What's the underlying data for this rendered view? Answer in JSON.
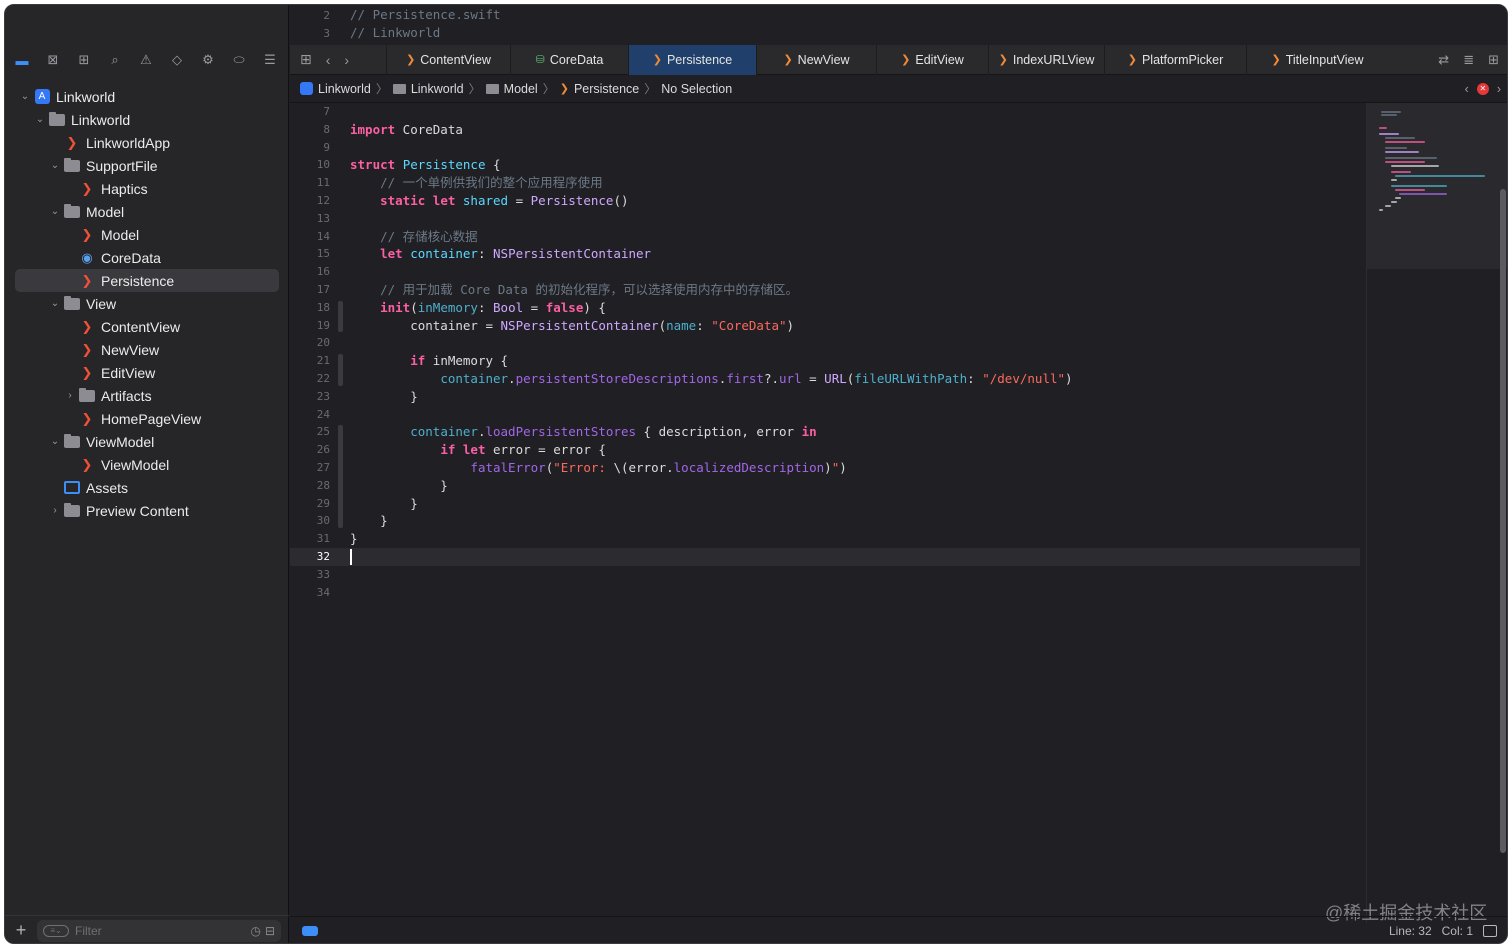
{
  "navigator": {
    "toolbar_icons": [
      "folder-icon",
      "source-control-icon",
      "symbol-icon",
      "find-icon",
      "issue-icon",
      "test-icon",
      "debug-icon",
      "breakpoint-icon",
      "report-icon"
    ],
    "tree": [
      {
        "label": "Linkworld",
        "indent": 0,
        "chevron": "⌄",
        "icon": "app"
      },
      {
        "label": "Linkworld",
        "indent": 1,
        "chevron": "⌄",
        "icon": "folder"
      },
      {
        "label": "LinkworldApp",
        "indent": 2,
        "chevron": "",
        "icon": "swift"
      },
      {
        "label": "SupportFile",
        "indent": 2,
        "chevron": "⌄",
        "icon": "folder"
      },
      {
        "label": "Haptics",
        "indent": 3,
        "chevron": "",
        "icon": "swift"
      },
      {
        "label": "Model",
        "indent": 2,
        "chevron": "⌄",
        "icon": "folder"
      },
      {
        "label": "Model",
        "indent": 3,
        "chevron": "",
        "icon": "swift"
      },
      {
        "label": "CoreData",
        "indent": 3,
        "chevron": "",
        "icon": "coredata"
      },
      {
        "label": "Persistence",
        "indent": 3,
        "chevron": "",
        "icon": "swift",
        "selected": true
      },
      {
        "label": "View",
        "indent": 2,
        "chevron": "⌄",
        "icon": "folder"
      },
      {
        "label": "ContentView",
        "indent": 3,
        "chevron": "",
        "icon": "swift"
      },
      {
        "label": "NewView",
        "indent": 3,
        "chevron": "",
        "icon": "swift"
      },
      {
        "label": "EditView",
        "indent": 3,
        "chevron": "",
        "icon": "swift"
      },
      {
        "label": "Artifacts",
        "indent": 3,
        "chevron": "›",
        "icon": "folder"
      },
      {
        "label": "HomePageView",
        "indent": 3,
        "chevron": "",
        "icon": "swift"
      },
      {
        "label": "ViewModel",
        "indent": 2,
        "chevron": "⌄",
        "icon": "folder"
      },
      {
        "label": "ViewModel",
        "indent": 3,
        "chevron": "",
        "icon": "swift"
      },
      {
        "label": "Assets",
        "indent": 2,
        "chevron": "",
        "icon": "assets"
      },
      {
        "label": "Preview Content",
        "indent": 2,
        "chevron": "›",
        "icon": "folder"
      }
    ],
    "filter_placeholder": "Filter"
  },
  "sticky": [
    {
      "num": "2",
      "text": "//  Persistence.swift"
    },
    {
      "num": "3",
      "text": "//  Linkworld"
    }
  ],
  "tabs": [
    {
      "label": "ContentView",
      "icon": "swift"
    },
    {
      "label": "CoreData",
      "icon": "coredata"
    },
    {
      "label": "Persistence",
      "icon": "swift",
      "active": true
    },
    {
      "label": "NewView",
      "icon": "swift"
    },
    {
      "label": "EditView",
      "icon": "swift"
    },
    {
      "label": "IndexURLView",
      "icon": "swift"
    },
    {
      "label": "PlatformPicker",
      "icon": "swift"
    },
    {
      "label": "TitleInputView",
      "icon": "swift"
    }
  ],
  "jumpbar": [
    "Linkworld",
    "Linkworld",
    "Model",
    "Persistence",
    "No Selection"
  ],
  "code": [
    {
      "num": "7",
      "tokens": []
    },
    {
      "num": "8",
      "tokens": [
        [
          "kw",
          "import"
        ],
        [
          "plain",
          " CoreData"
        ]
      ]
    },
    {
      "num": "9",
      "tokens": []
    },
    {
      "num": "10",
      "tokens": [
        [
          "kw",
          "struct"
        ],
        [
          "plain",
          " "
        ],
        [
          "typ",
          "Persistence"
        ],
        [
          "plain",
          " {"
        ]
      ]
    },
    {
      "num": "11",
      "tokens": [
        [
          "cm",
          "    // 一个单例供我们的整个应用程序使用"
        ]
      ]
    },
    {
      "num": "12",
      "tokens": [
        [
          "plain",
          "    "
        ],
        [
          "kw",
          "static"
        ],
        [
          "plain",
          " "
        ],
        [
          "kw",
          "let"
        ],
        [
          "plain",
          " "
        ],
        [
          "typ",
          "shared"
        ],
        [
          "plain",
          " = "
        ],
        [
          "ty",
          "Persistence"
        ],
        [
          "plain",
          "()"
        ]
      ]
    },
    {
      "num": "13",
      "tokens": []
    },
    {
      "num": "14",
      "tokens": [
        [
          "cm",
          "    // 存储核心数据"
        ]
      ]
    },
    {
      "num": "15",
      "tokens": [
        [
          "plain",
          "    "
        ],
        [
          "kw",
          "let"
        ],
        [
          "plain",
          " "
        ],
        [
          "typ",
          "container"
        ],
        [
          "plain",
          ": "
        ],
        [
          "ty",
          "NSPersistentContainer"
        ]
      ]
    },
    {
      "num": "16",
      "tokens": []
    },
    {
      "num": "17",
      "tokens": [
        [
          "cm",
          "    // 用于加载 Core Data 的初始化程序，可以选择使用内存中的存储区。"
        ]
      ]
    },
    {
      "num": "18",
      "tokens": [
        [
          "plain",
          "    "
        ],
        [
          "kw",
          "init"
        ],
        [
          "plain",
          "("
        ],
        [
          "mem",
          "inMemory"
        ],
        [
          "plain",
          ": "
        ],
        [
          "ty",
          "Bool"
        ],
        [
          "plain",
          " = "
        ],
        [
          "kw",
          "false"
        ],
        [
          "plain",
          ") {"
        ]
      ]
    },
    {
      "num": "19",
      "tokens": [
        [
          "plain",
          "        container = "
        ],
        [
          "ty",
          "NSPersistentContainer"
        ],
        [
          "plain",
          "("
        ],
        [
          "mem",
          "name"
        ],
        [
          "plain",
          ": "
        ],
        [
          "str",
          "\"CoreData\""
        ],
        [
          "plain",
          ")"
        ]
      ]
    },
    {
      "num": "20",
      "tokens": []
    },
    {
      "num": "21",
      "tokens": [
        [
          "plain",
          "        "
        ],
        [
          "kw",
          "if"
        ],
        [
          "plain",
          " inMemory {"
        ]
      ]
    },
    {
      "num": "22",
      "tokens": [
        [
          "plain",
          "            "
        ],
        [
          "mem",
          "container"
        ],
        [
          "plain",
          "."
        ],
        [
          "lbl",
          "persistentStoreDescriptions"
        ],
        [
          "plain",
          "."
        ],
        [
          "lbl",
          "first"
        ],
        [
          "plain",
          "?."
        ],
        [
          "lbl",
          "url"
        ],
        [
          "plain",
          " = "
        ],
        [
          "ty",
          "URL"
        ],
        [
          "plain",
          "("
        ],
        [
          "mem",
          "fileURLWithPath"
        ],
        [
          "plain",
          ": "
        ],
        [
          "str",
          "\"/dev/null\""
        ],
        [
          "plain",
          ")"
        ]
      ]
    },
    {
      "num": "23",
      "tokens": [
        [
          "plain",
          "        }"
        ]
      ]
    },
    {
      "num": "24",
      "tokens": []
    },
    {
      "num": "25",
      "tokens": [
        [
          "plain",
          "        "
        ],
        [
          "mem",
          "container"
        ],
        [
          "plain",
          "."
        ],
        [
          "lbl",
          "loadPersistentStores"
        ],
        [
          "plain",
          " { description, error "
        ],
        [
          "kw",
          "in"
        ]
      ]
    },
    {
      "num": "26",
      "tokens": [
        [
          "plain",
          "            "
        ],
        [
          "kw",
          "if"
        ],
        [
          "plain",
          " "
        ],
        [
          "kw",
          "let"
        ],
        [
          "plain",
          " error = error {"
        ]
      ]
    },
    {
      "num": "27",
      "tokens": [
        [
          "plain",
          "                "
        ],
        [
          "lbl",
          "fatalError"
        ],
        [
          "plain",
          "("
        ],
        [
          "str",
          "\"Error: "
        ],
        [
          "plain",
          "\\(error."
        ],
        [
          "lbl",
          "localizedDescription"
        ],
        [
          "plain",
          ")"
        ],
        [
          "str",
          "\""
        ],
        [
          "plain",
          ")"
        ]
      ]
    },
    {
      "num": "28",
      "tokens": [
        [
          "plain",
          "            }"
        ]
      ]
    },
    {
      "num": "29",
      "tokens": [
        [
          "plain",
          "        }"
        ]
      ]
    },
    {
      "num": "30",
      "tokens": [
        [
          "plain",
          "    }"
        ]
      ]
    },
    {
      "num": "31",
      "tokens": [
        [
          "plain",
          "}"
        ]
      ]
    },
    {
      "num": "32",
      "tokens": [],
      "current": true
    },
    {
      "num": "33",
      "tokens": []
    },
    {
      "num": "34",
      "tokens": []
    }
  ],
  "status": {
    "line": "Line: 32",
    "col": "Col: 1"
  },
  "watermark": "@稀土掘金技术社区",
  "colors": {
    "accent": "#3d8ef7",
    "swift": "#f05138",
    "keyword": "#fc5fa3",
    "string": "#fc6a5d",
    "comment": "#6c7986",
    "active_tab": "#20406b"
  }
}
